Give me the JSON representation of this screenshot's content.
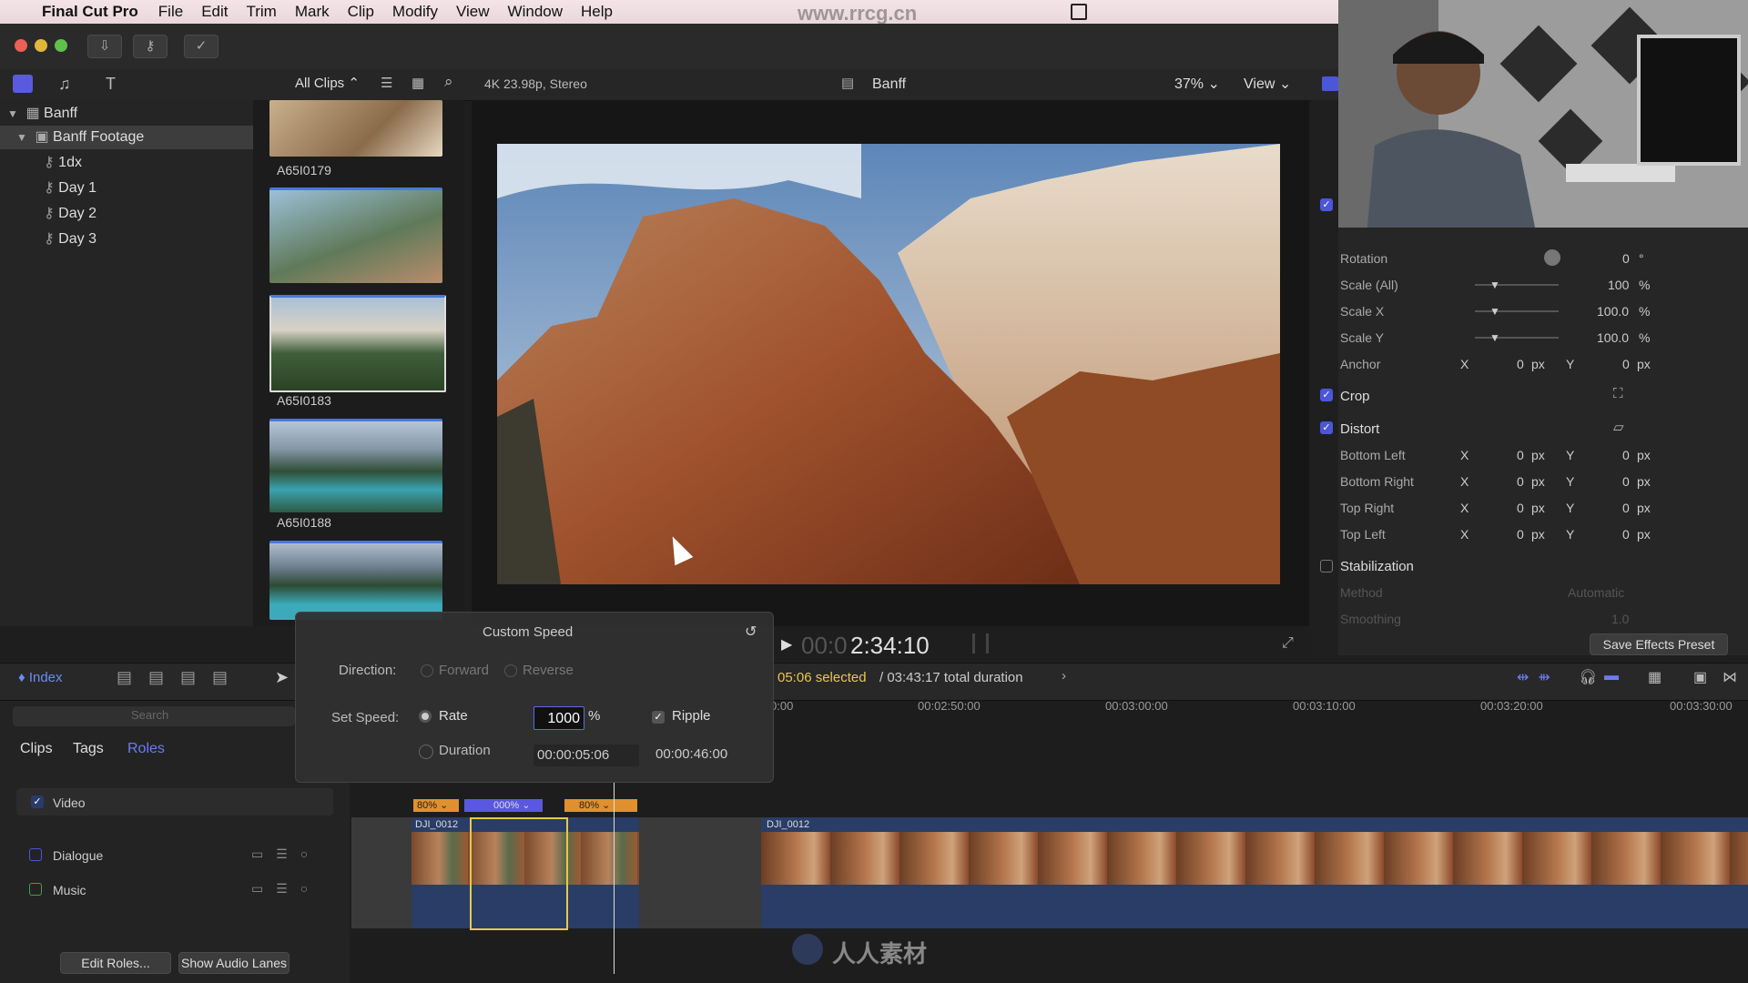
{
  "menubar": {
    "app": "Final Cut Pro",
    "items": [
      "File",
      "Edit",
      "Trim",
      "Mark",
      "Clip",
      "Modify",
      "View",
      "Window",
      "Help"
    ],
    "watermark_url": "www.rrcg.cn"
  },
  "browser": {
    "filter": "All Clips",
    "clips": [
      "A65I0179",
      "A65I0183",
      "A65I0188"
    ]
  },
  "libraries": {
    "library": "Banff",
    "event": "Banff Footage",
    "keywords": [
      "1dx",
      "Day 1",
      "Day 2",
      "Day 3"
    ]
  },
  "viewer": {
    "format": "4K 23.98p, Stereo",
    "project": "Banff",
    "zoom": "37%",
    "view_label": "View",
    "timecode": "2:34:10",
    "timecode_dim": "00:0"
  },
  "inspector": {
    "rotation": {
      "label": "Rotation",
      "value": "0",
      "unit": "°"
    },
    "scale_all": {
      "label": "Scale (All)",
      "value": "100",
      "unit": "%"
    },
    "scale_x": {
      "label": "Scale X",
      "value": "100.0",
      "unit": "%"
    },
    "scale_y": {
      "label": "Scale Y",
      "value": "100.0",
      "unit": "%"
    },
    "anchor": {
      "label": "Anchor",
      "x": "0",
      "y": "0",
      "unit": "px"
    },
    "crop": "Crop",
    "distort": "Distort",
    "distort_rows": [
      {
        "label": "Bottom Left",
        "x": "0",
        "y": "0"
      },
      {
        "label": "Bottom Right",
        "x": "0",
        "y": "0"
      },
      {
        "label": "Top Right",
        "x": "0",
        "y": "0"
      },
      {
        "label": "Top Left",
        "x": "0",
        "y": "0"
      }
    ],
    "px": "px",
    "x_lbl": "X",
    "y_lbl": "Y",
    "stabilization": "Stabilization",
    "method_label": "Method",
    "method_value": "Automatic",
    "smoothing_label": "Smoothing",
    "smoothing_value": "1.0",
    "save_preset": "Save Effects Preset"
  },
  "custom_speed": {
    "title": "Custom Speed",
    "direction_label": "Direction:",
    "forward": "Forward",
    "reverse": "Reverse",
    "set_speed_label": "Set Speed:",
    "rate_label": "Rate",
    "rate_value": "1000",
    "rate_unit": "%",
    "ripple": "Ripple",
    "duration_label": "Duration",
    "duration_value": "00:00:05:06",
    "duration_total": "00:00:46:00"
  },
  "timeline": {
    "index_label": "Index",
    "selected": "05:06 selected",
    "total": "/ 03:43:17 total duration",
    "tabs": [
      "Clips",
      "Tags",
      "Roles"
    ],
    "search_placeholder": "Search",
    "roles": [
      {
        "name": "Video",
        "checked": true
      },
      {
        "name": "Dialogue",
        "checked": false
      },
      {
        "name": "Music",
        "checked": false
      }
    ],
    "edit_roles": "Edit Roles...",
    "show_audio_lanes": "Show Audio Lanes",
    "ruler": [
      "0:00",
      "00:02:50:00",
      "00:03:00:00",
      "00:03:10:00",
      "00:03:20:00",
      "00:03:30:00"
    ],
    "speed_tags": [
      "80%",
      "000%",
      "80%"
    ],
    "clip_names": [
      "DJI_0012",
      "DJI_0012"
    ],
    "footer_watermark": "人人素材"
  },
  "colors": {
    "accent": "#4c56d9",
    "selection": "#e8c84a",
    "speed_orange": "#e0902e",
    "speed_blue": "#5a58e0",
    "selected_text": "#e8c84a"
  }
}
